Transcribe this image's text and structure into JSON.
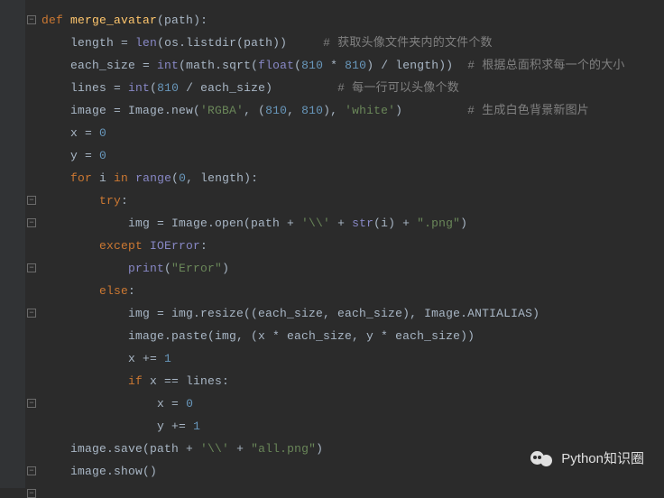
{
  "code": {
    "l1": {
      "def": "def ",
      "name": "merge_avatar",
      "p1": "(",
      "arg": "path",
      "p2": "):"
    },
    "l2": {
      "i": "    ",
      "v": "length ",
      "eq": "= ",
      "b": "len",
      "p1": "(",
      "os": "os.listdir",
      "p2": "(",
      "arg": "path",
      "p3": "))     ",
      "c": "# 获取头像文件夹内的文件个数"
    },
    "l3": {
      "i": "    ",
      "v": "each_size ",
      "eq": "= ",
      "b1": "int",
      "p1": "(",
      "m": "math.sqrt",
      "p2": "(",
      "b2": "float",
      "p3": "(",
      "n1": "810 ",
      "op": "* ",
      "n2": "810",
      "p4": ") / ",
      "lg": "length",
      "p5": "))  ",
      "c": "# 根据总面积求每一个的大小"
    },
    "l4": {
      "i": "    ",
      "v": "lines ",
      "eq": "= ",
      "b": "int",
      "p1": "(",
      "n": "810 ",
      "op": "/ each_size)         ",
      "c": "# 每一行可以头像个数"
    },
    "l5": {
      "i": "    ",
      "v": "image ",
      "eq": "= Image.new(",
      "s1": "'RGBA'",
      "p1": ", (",
      "n1": "810",
      "p2": ", ",
      "n2": "810",
      "p3": "), ",
      "s2": "'white'",
      "p4": ")         ",
      "c": "# 生成白色背景新图片"
    },
    "l6": {
      "i": "    ",
      "v": "x ",
      "eq": "= ",
      "n": "0"
    },
    "l7": {
      "i": "    ",
      "v": "y ",
      "eq": "= ",
      "n": "0"
    },
    "l8": {
      "i": "    ",
      "for": "for ",
      "iv": "i ",
      "in": "in ",
      "rg": "range",
      "p1": "(",
      "n": "0",
      "p2": ", length):"
    },
    "l9": {
      "i": "        ",
      "kw": "try",
      "p": ":"
    },
    "l10": {
      "i": "            ",
      "v": "img = Image.open(path + ",
      "s1": "'\\\\'",
      "op": " + ",
      "b": "str",
      "p1": "(i) + ",
      "s2": "\".png\"",
      "p2": ")"
    },
    "l11": {
      "i": "        ",
      "kw": "except ",
      "ex": "IOError",
      "p": ":"
    },
    "l12": {
      "i": "            ",
      "b": "print",
      "p1": "(",
      "s": "\"Error\"",
      "p2": ")"
    },
    "l13": {
      "i": "        ",
      "kw": "else",
      "p": ":"
    },
    "l14": {
      "i": "            ",
      "v": "img = img.resize((each_size, each_size), Image.ANTIALIAS)"
    },
    "l15": {
      "i": "            ",
      "v": "image.paste(img, (x * each_size, y * each_size))"
    },
    "l16": {
      "i": "            ",
      "v": "x ",
      "op": "+= ",
      "n": "1"
    },
    "l17": {
      "i": "            ",
      "kw": "if ",
      "v": "x == lines:"
    },
    "l18": {
      "i": "                ",
      "v": "x ",
      "eq": "= ",
      "n": "0"
    },
    "l19": {
      "i": "                ",
      "v": "y ",
      "op": "+= ",
      "n": "1"
    },
    "l20": {
      "i": "    ",
      "v": "image.save(path + ",
      "s1": "'\\\\'",
      "op": " + ",
      "s2": "\"all.png\"",
      "p": ")"
    },
    "l21": {
      "i": "    ",
      "v": "image.show()"
    }
  },
  "watermark": "Python知识圈"
}
